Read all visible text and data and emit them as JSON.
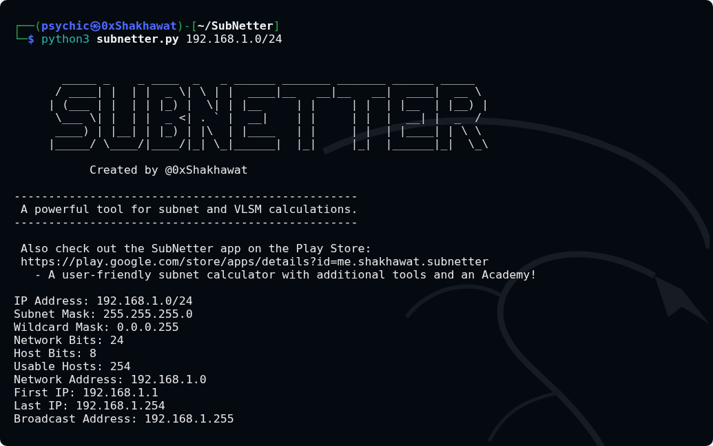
{
  "prompt": {
    "corner_top": "┌──(",
    "user": "psychic",
    "separator": "㉿",
    "host": "0xShakhawat",
    "close_paren": ")-[",
    "path": "~/SubNetter",
    "close_bracket": "]",
    "corner_bottom": "└─",
    "symbol": "$",
    "command": "python3",
    "script": "subnetter.py",
    "argument": "192.168.1.0/24"
  },
  "banner": {
    "art": [
      "  _____ _    _ ____  _   _ ______ _______ _______ ______ _____",
      " / ____| |  | |  _ \\| \\ | |  ____|__   __|__   __|  ____|  __ \\",
      "| (___ | |  | | |_) |  \\| | |__     | |     | |  | |__  | |__) |",
      " \\___ \\| |  | |  _ <| . ` |  __|    | |     | |  |  __| |  _  /",
      " ____) | |__| | |_) | |\\  | |____   | |     | |  | |____| | \\ \\",
      "|_____/ \\____/|____/|_| \\_|______|  |_|     |_|  |______|_|  \\_\\"
    ],
    "credit": "Created by @0xShakhawat"
  },
  "rule_top": "--------------------------------------------------",
  "tagline": "A powerful tool for subnet and VLSM calculations.",
  "rule_bottom": "--------------------------------------------------",
  "promo": {
    "text": "Also check out the SubNetter app on the Play Store:",
    "link": "https://play.google.com/store/apps/details?id=me.shakhawat.subnetter",
    "note": "- A user-friendly subnet calculator with additional tools and an Academy!"
  },
  "results": [
    "IP Address: 192.168.1.0/24",
    "Subnet Mask: 255.255.255.0",
    "Wildcard Mask: 0.0.0.255",
    "Network Bits: 24",
    "Host Bits: 8",
    "Usable Hosts: 254",
    "Network Address: 192.168.1.0",
    "First IP: 192.168.1.1",
    "Last IP: 192.168.1.254",
    "Broadcast Address: 192.168.1.255"
  ]
}
